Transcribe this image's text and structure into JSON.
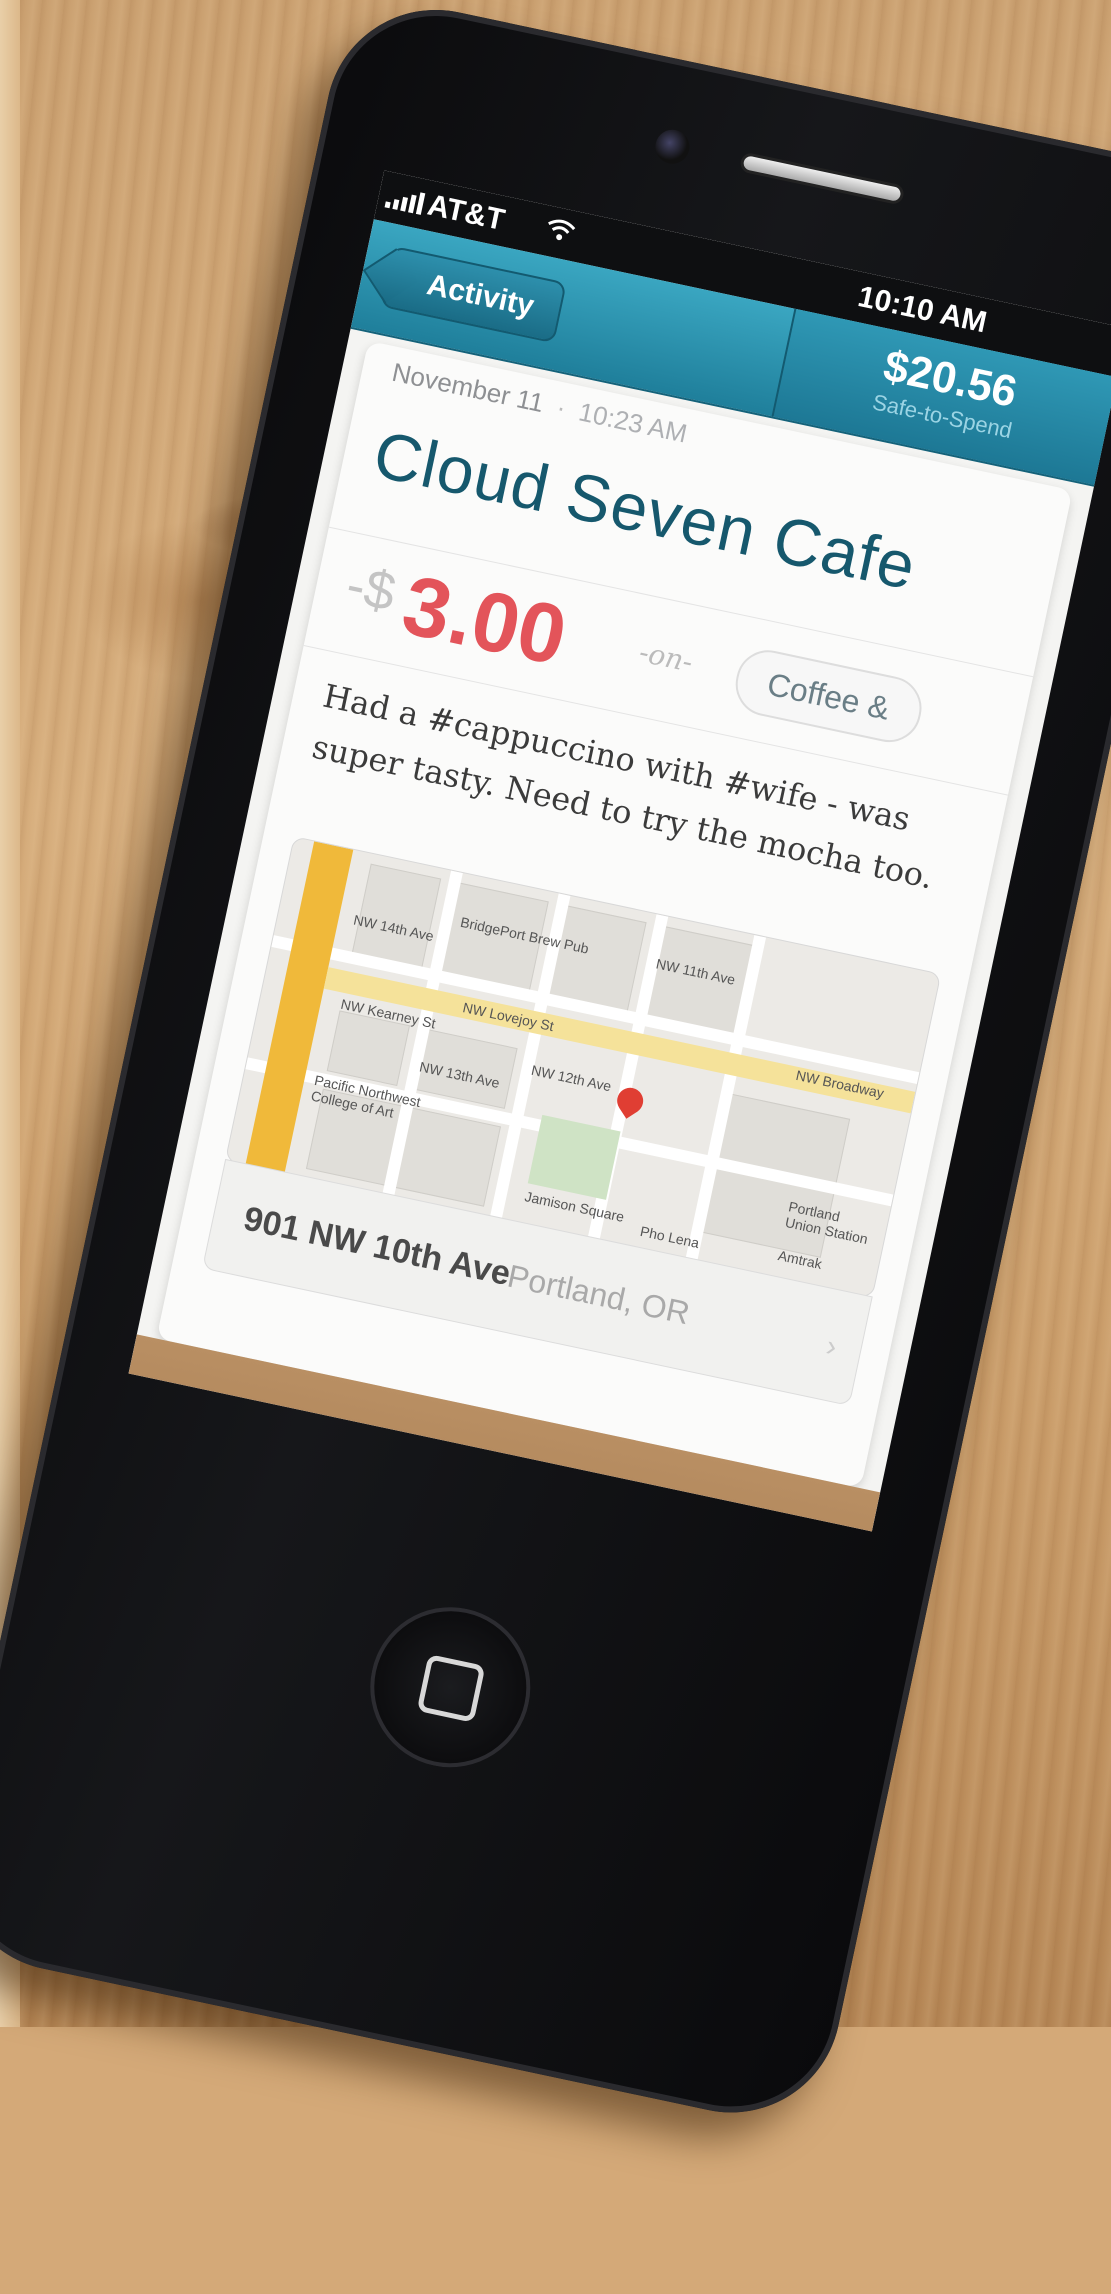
{
  "status": {
    "carrier": "AT&T",
    "time": "10:10 AM"
  },
  "nav": {
    "back_label": "Activity",
    "balance_amount": "$20.56",
    "balance_label": "Safe-to-Spend"
  },
  "transaction": {
    "date": "November 11",
    "time": "10:23 AM",
    "merchant": "Cloud Seven Cafe",
    "sign": "-$",
    "amount": "3.00",
    "connector": "-on-",
    "category": "Coffee &",
    "note": "Had a #cappuccino with #wife - was super tasty. Need to try the mocha too."
  },
  "map": {
    "labels": [
      "NW Lovejoy St",
      "NW Kearney St",
      "Jamison Square",
      "Pacific Northwest College of Art",
      "BridgePort Brew Pub",
      "NW Broadway",
      "Portland Union Station",
      "Amtrak",
      "NW 11th Ave",
      "NW 12th Ave",
      "NW 13th Ave",
      "NW 14th Ave",
      "Pho Lena"
    ]
  },
  "address": {
    "street": "901 NW 10th Ave",
    "city": "Portland, OR"
  },
  "toolbar": {
    "back_icon": "arrow-left-icon",
    "settings_icon": "gear-icon",
    "forward_icon": "arrow-right-icon"
  }
}
